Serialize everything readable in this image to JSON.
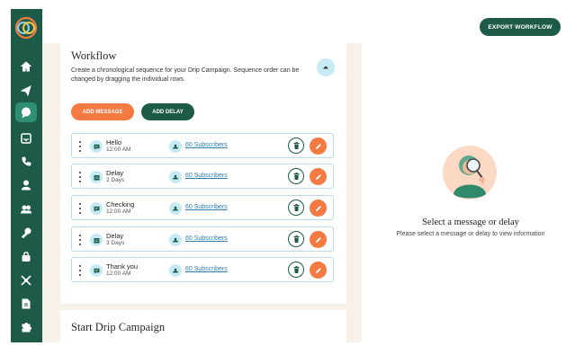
{
  "sidebar": {
    "brand_colors": {
      "bg": "#1d5b48",
      "active": "#2f8f73"
    },
    "items": [
      {
        "icon": "home-icon"
      },
      {
        "icon": "send-icon"
      },
      {
        "icon": "chat-icon",
        "active": true
      },
      {
        "icon": "inbox-icon"
      },
      {
        "icon": "phone-icon"
      },
      {
        "icon": "person-icon"
      },
      {
        "icon": "group-icon"
      },
      {
        "icon": "key-icon"
      },
      {
        "icon": "lock-icon"
      },
      {
        "icon": "shuffle-icon"
      },
      {
        "icon": "document-icon"
      },
      {
        "icon": "puzzle-icon"
      }
    ]
  },
  "header": {
    "export_label": "EXPORT WORKFLOW"
  },
  "workflow": {
    "title": "Workflow",
    "description": "Create a chronological sequence for your Drip Campaign. Sequence order can be changed by dragging the individual rows.",
    "add_message_label": "ADD MESSAGE",
    "add_delay_label": "ADD DELAY",
    "rows": [
      {
        "type": "message",
        "name": "Hello",
        "detail": "12:00 AM",
        "subscribers": "60 Subscribers"
      },
      {
        "type": "delay",
        "name": "Delay",
        "detail": "2 Days",
        "subscribers": "60 Subscribers"
      },
      {
        "type": "message",
        "name": "Checking",
        "detail": "12:00 AM",
        "subscribers": "60 Subscribers"
      },
      {
        "type": "delay",
        "name": "Delay",
        "detail": "3 Days",
        "subscribers": "60 Subscribers"
      },
      {
        "type": "message",
        "name": "Thank you",
        "detail": "12:00 AM",
        "subscribers": "60 Subscribers"
      }
    ]
  },
  "start_section": {
    "title": "Start Drip Campaign"
  },
  "empty_state": {
    "title": "Select a message or delay",
    "description": "Please select a message or delay to view information"
  },
  "colors": {
    "accent_orange": "#f47a42",
    "link_blue": "#2d7cb3",
    "light_blue": "#c6ebf5"
  }
}
